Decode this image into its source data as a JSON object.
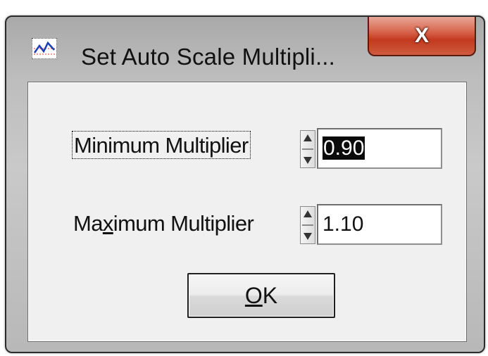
{
  "window": {
    "title": "Set Auto Scale Multipli...",
    "close_label": "X"
  },
  "fields": {
    "min": {
      "label": "Minimum Multiplier",
      "value": "0.90"
    },
    "max": {
      "label_pre": "Ma",
      "label_accel": "x",
      "label_post": "imum Multiplier",
      "value": "1.10"
    }
  },
  "buttons": {
    "ok_accel": "O",
    "ok_rest": "K"
  },
  "icons": {
    "app": "graph-line-icon",
    "spin": "up-down-arrows-icon"
  }
}
